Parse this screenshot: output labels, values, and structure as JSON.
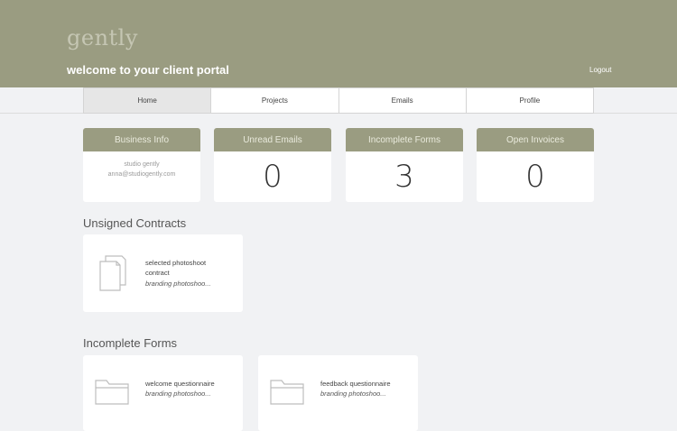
{
  "header": {
    "logo_text": "gently",
    "welcome": "welcome to your client portal",
    "logout": "Logout"
  },
  "nav": {
    "tabs": [
      {
        "label": "Home",
        "active": true
      },
      {
        "label": "Projects",
        "active": false
      },
      {
        "label": "Emails",
        "active": false
      },
      {
        "label": "Profile",
        "active": false
      }
    ]
  },
  "stats": {
    "business": {
      "title": "Business Info",
      "name": "studio gently",
      "email": "anna@studiogently.com"
    },
    "unread": {
      "title": "Unread Emails",
      "value": "0"
    },
    "forms": {
      "title": "Incomplete Forms",
      "value": "3"
    },
    "invoices": {
      "title": "Open Invoices",
      "value": "0"
    }
  },
  "contracts": {
    "title": "Unsigned Contracts",
    "items": [
      {
        "name_line1": "selected photoshoot",
        "name_line2": "contract",
        "project": "branding photoshoo..."
      }
    ]
  },
  "forms": {
    "title": "Incomplete Forms",
    "items": [
      {
        "name": "welcome questionnaire",
        "project": "branding photoshoo..."
      },
      {
        "name": "feedback questionnaire",
        "project": "branding photoshoo..."
      }
    ]
  },
  "colors": {
    "brand": "#9a9c81",
    "background": "#f1f2f4",
    "card": "#ffffff"
  },
  "icons": [
    "document-icon",
    "folder-icon"
  ]
}
